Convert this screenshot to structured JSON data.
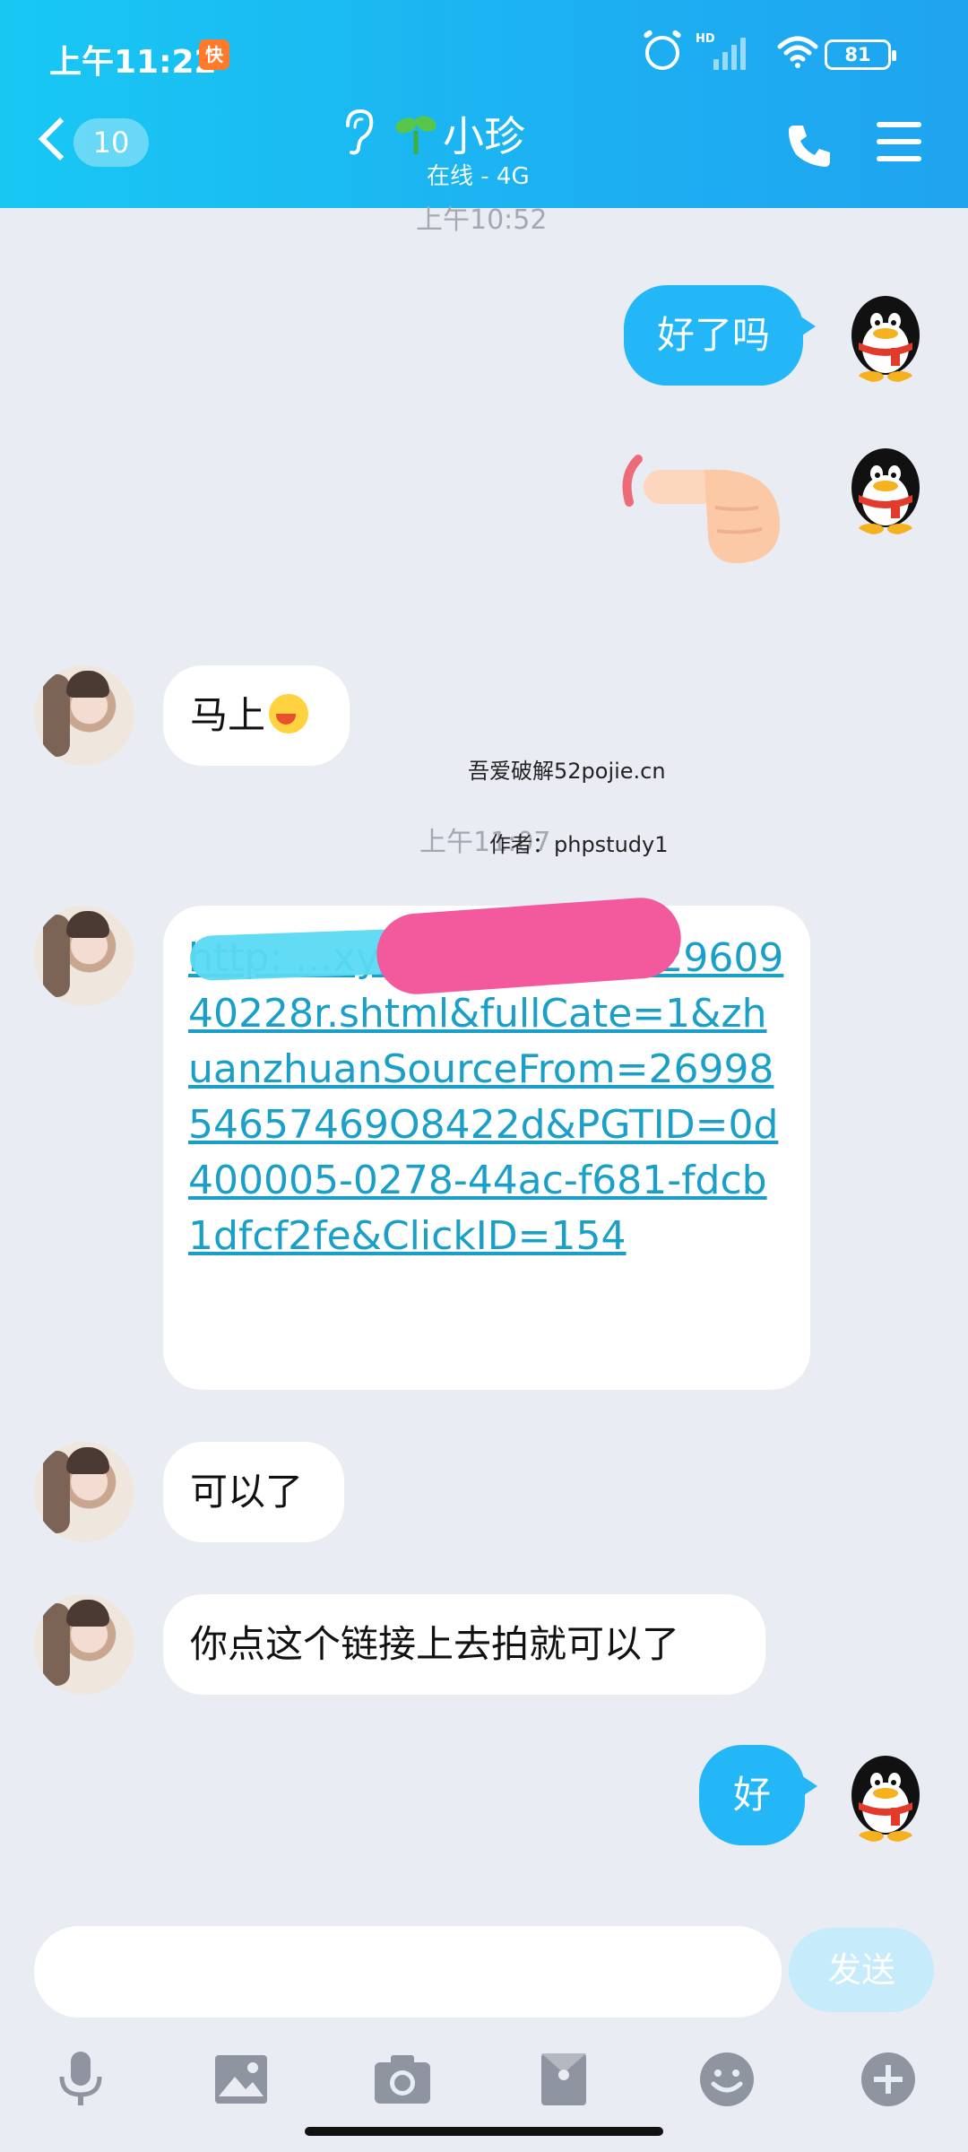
{
  "status_bar": {
    "time": "上午11:22",
    "app_icon_label": "快",
    "hd_label": "HD",
    "battery": "81"
  },
  "header": {
    "unread_count": "10",
    "contact_name": "小珍",
    "contact_status": "在线 - 4G"
  },
  "messages": {
    "ts1": "上午10:52",
    "m1": "好了吗",
    "m3": "马上",
    "ts2": "上午11:07",
    "link": "http:                              ...xy/?i=005650342960940228r.shtml&fullCate=1&zhuanzhuanSourceFrom=2699854657469O8422d&PGTID=0d400005-0278-44ac-f681-fdcb1dfcf2fe&ClickID=154",
    "m5": "可以了",
    "m6": "你点这个链接上去拍就可以了",
    "m7": "好"
  },
  "watermark": {
    "site": "吾爱破解52pojie.cn",
    "author": "作者：phpstudy1"
  },
  "composer": {
    "send_label": "发送"
  },
  "icons": [
    "alarm-icon",
    "wifi-icon",
    "battery-icon",
    "back-icon",
    "ear-icon",
    "sprout-icon",
    "phone-icon",
    "menu-icon",
    "mic-icon",
    "image-icon",
    "camera-icon",
    "red-packet-icon",
    "smiley-icon",
    "plus-icon"
  ],
  "colors": {
    "header_start": "#18c8f3",
    "header_end": "#1fa4f0",
    "outgoing_bubble": "#23b7f7",
    "link": "#1aa0c8"
  }
}
